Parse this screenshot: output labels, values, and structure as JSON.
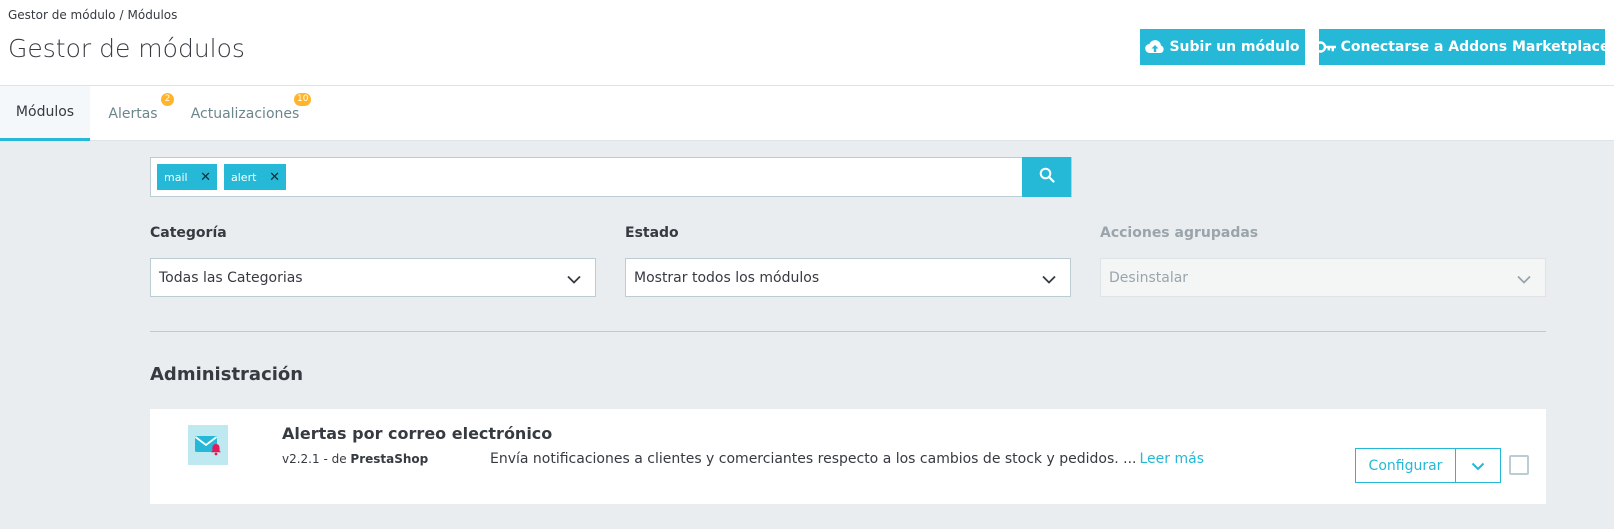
{
  "breadcrumb": {
    "items": [
      "Gestor de módulo",
      "Módulos"
    ],
    "separator": "/"
  },
  "page": {
    "title": "Gestor de módulos"
  },
  "toolbar": {
    "upload_label": "Subir un módulo",
    "upload_icon": "cloud-upload-icon",
    "addons_label": "Conectarse a Addons Marketplace",
    "addons_icon": "key-icon"
  },
  "tabs": [
    {
      "label": "Módulos",
      "active": true
    },
    {
      "label": "Alertas",
      "badge": "2"
    },
    {
      "label": "Actualizaciones",
      "badge": "10"
    }
  ],
  "search": {
    "tags": [
      "mail",
      "alert"
    ],
    "remove_icon": "close-icon",
    "button_icon": "search-icon"
  },
  "filters": {
    "category": {
      "label": "Categoría",
      "value": "Todas las Categorias"
    },
    "status": {
      "label": "Estado",
      "value": "Mostrar todos los módulos"
    },
    "bulk": {
      "label": "Acciones agrupadas",
      "value": "Desinstalar",
      "disabled": true
    }
  },
  "section": {
    "title": "Administración"
  },
  "module": {
    "name": "Alertas por correo electrónico",
    "version": "v2.2.1 - de",
    "author": "PrestaShop",
    "description": "Envía notificaciones a clientes y comerciantes respecto a los cambios de stock y pedidos. ...",
    "read_more": "Leer más",
    "configure_label": "Configurar",
    "icon": "mail-alert-icon"
  },
  "colors": {
    "primary": "#25b9d7",
    "badge": "#ffb42b",
    "text": "#363a41",
    "background": "#eaedf0"
  }
}
